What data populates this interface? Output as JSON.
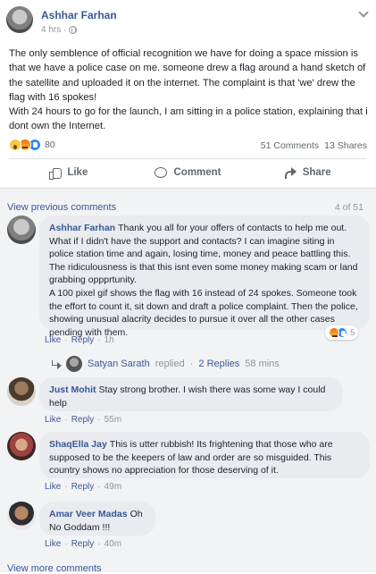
{
  "post": {
    "author": "Ashhar Farhan",
    "time": "4 hrs ·",
    "text": "The only semblence of official recognition we have for doing a space mission is that we have a police case on me. someone drew a flag around a hand sketch of the satellite and uploaded it on the internet. The complaint is that 'we' drew the flag with 16 spokes!\nWith 24 hours to go for the launch, I am sitting in a police station, explaining that i dont own the Internet.",
    "reaction_count": "80",
    "comments_count": "51 Comments",
    "shares_count": "13 Shares",
    "actions": {
      "like": "Like",
      "comment": "Comment",
      "share": "Share"
    }
  },
  "comments_section": {
    "view_previous": "View previous comments",
    "counter": "4 of 51",
    "view_more": "View more comments",
    "items": [
      {
        "name": "Ashhar Farhan",
        "text": "Thank you all for your offers of contacts to help me out. What if I didn't have the support and contacts? I can imagine siting in police station time and again, losing time, money and peace battling this. The ridiculousness is that this isnt even some money making scam or land grabbing oppprtunity.\nA 100 pixel gif shows the flag with 16 instead of 24 spokes. Someone took the effort to count it, sit down and draft a police complaint. Then the police, showing unusual alacrity decides to pursue it over all the other cases pending with them.",
        "like": "Like",
        "reply": "Reply",
        "time": "1h",
        "reaction_count": "5"
      },
      {
        "name": "Just Mohit",
        "text": "Stay strong brother. I wish there was some way I could help",
        "like": "Like",
        "reply": "Reply",
        "time": "55m"
      },
      {
        "name": "ShaqElla Jay",
        "text": "This is utter rubbish! Its frightening that those who are supposed to be the keepers of law and order are so misguided. This country shows no appreciation for those deserving of it.",
        "like": "Like",
        "reply": "Reply",
        "time": "49m"
      },
      {
        "name": "Amar Veer Madas",
        "text": "Oh No Goddam !!!",
        "like": "Like",
        "reply": "Reply",
        "time": "40m"
      }
    ],
    "reply_thread": {
      "name": "Satyan Sarath",
      "replied": "replied",
      "sep": "·",
      "replies": "2 Replies",
      "time": "58 mins"
    }
  },
  "icons": {
    "globe": "globe-icon",
    "chevron": "chevron-down-icon",
    "like": "like-icon",
    "comment": "comment-icon",
    "share": "share-icon",
    "reply_arrow": "reply-arrow-icon"
  },
  "colors": {
    "link": "#385898",
    "author": "#365899",
    "muted": "#90949c",
    "bubble": "#e9ebee",
    "background": "#f2f3f5"
  }
}
